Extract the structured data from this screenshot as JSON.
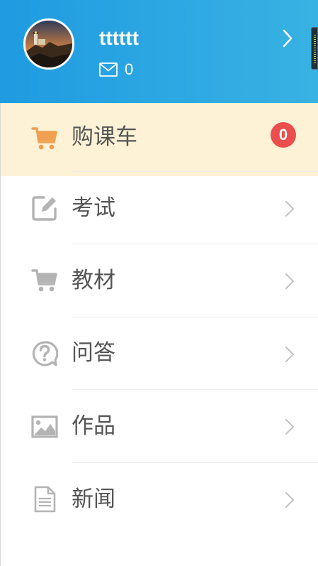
{
  "profile": {
    "username": "tttttt",
    "mail_count": "0"
  },
  "icons": {
    "avatar": "lighthouse-photo",
    "mail": "envelope-icon",
    "header_chevron": "chevron-right-icon"
  },
  "menu": {
    "items": [
      {
        "label": "购课车",
        "icon": "cart-icon",
        "badge": "0",
        "active": true
      },
      {
        "label": "考试",
        "icon": "edit-icon"
      },
      {
        "label": "教材",
        "icon": "cart-icon"
      },
      {
        "label": "问答",
        "icon": "question-icon"
      },
      {
        "label": "作品",
        "icon": "image-icon"
      },
      {
        "label": "新闻",
        "icon": "document-icon"
      }
    ]
  },
  "colors": {
    "header": "#1e9be1",
    "active_bg": "#fdf2d5",
    "active_icon": "#f0a050",
    "badge": "#ec4d4d",
    "icon_gray": "#b4b4b4",
    "label": "#555555"
  }
}
